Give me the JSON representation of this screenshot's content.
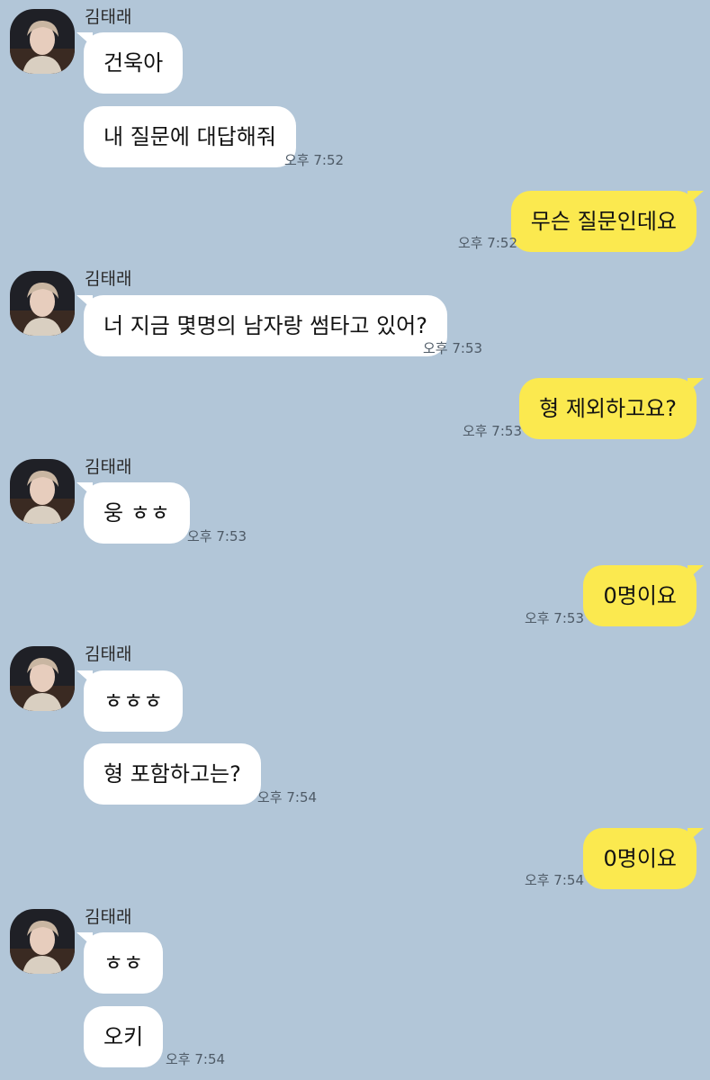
{
  "contact": {
    "name": "김태래"
  },
  "colors": {
    "background": "#b2c6d8",
    "received_bubble": "#ffffff",
    "sent_bubble": "#fbe94f"
  },
  "messages": [
    {
      "direction": "received",
      "text": "건욱아"
    },
    {
      "direction": "received",
      "text": "내 질문에 대답해줘",
      "time": "오후 7:52"
    },
    {
      "direction": "sent",
      "text": "무슨 질문인데요",
      "time": "오후 7:52"
    },
    {
      "direction": "received",
      "text": "너 지금 몇명의 남자랑 썸타고 있어?",
      "time": "오후 7:53"
    },
    {
      "direction": "sent",
      "text": "형 제외하고요?",
      "time": "오후 7:53"
    },
    {
      "direction": "received",
      "text": "웅 ㅎㅎ",
      "time": "오후 7:53"
    },
    {
      "direction": "sent",
      "text": "0명이요",
      "time": "오후 7:53"
    },
    {
      "direction": "received",
      "text": "ㅎㅎㅎ"
    },
    {
      "direction": "received",
      "text": "형 포함하고는?",
      "time": "오후 7:54"
    },
    {
      "direction": "sent",
      "text": "0명이요",
      "time": "오후 7:54"
    },
    {
      "direction": "received",
      "text": "ㅎㅎ"
    },
    {
      "direction": "received",
      "text": "오키",
      "time": "오후 7:54"
    }
  ]
}
